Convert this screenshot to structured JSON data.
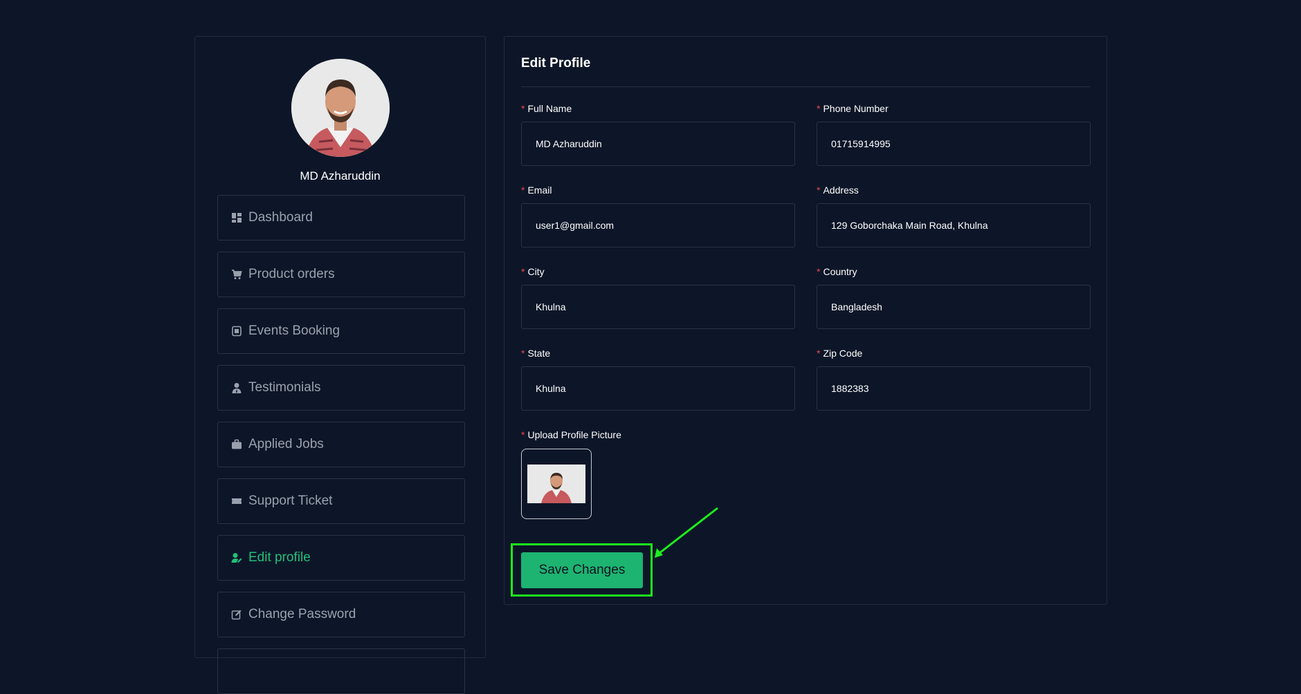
{
  "user": {
    "name": "MD Azharuddin"
  },
  "sidebar": {
    "items": [
      {
        "label": "Dashboard",
        "icon": "dashboard-icon",
        "active": false
      },
      {
        "label": "Product orders",
        "icon": "cart-icon",
        "active": false
      },
      {
        "label": "Events Booking",
        "icon": "booking-icon",
        "active": false
      },
      {
        "label": "Testimonials",
        "icon": "user-tie-icon",
        "active": false
      },
      {
        "label": "Applied Jobs",
        "icon": "briefcase-icon",
        "active": false
      },
      {
        "label": "Support Ticket",
        "icon": "ticket-icon",
        "active": false
      },
      {
        "label": "Edit profile",
        "icon": "user-edit-icon",
        "active": true
      },
      {
        "label": "Change Password",
        "icon": "edit-icon",
        "active": false
      }
    ]
  },
  "form": {
    "title": "Edit Profile",
    "required_mark": "*",
    "full_name": {
      "label": "Full Name",
      "value": "MD Azharuddin"
    },
    "phone": {
      "label": "Phone Number",
      "value": "01715914995"
    },
    "email": {
      "label": "Email",
      "value": "user1@gmail.com"
    },
    "address": {
      "label": "Address",
      "value": "129 Goborchaka Main Road, Khulna"
    },
    "city": {
      "label": "City",
      "value": "Khulna"
    },
    "country": {
      "label": "Country",
      "value": "Bangladesh"
    },
    "state": {
      "label": "State",
      "value": "Khulna"
    },
    "zip": {
      "label": "Zip Code",
      "value": "1882383"
    },
    "upload": {
      "label": "Upload Profile Picture"
    },
    "save_label": "Save Changes"
  },
  "colors": {
    "background": "#0d1628",
    "accent": "#1db471",
    "active_nav": "#22c07a",
    "required": "#e5484d",
    "annotation": "#1cf01c"
  }
}
